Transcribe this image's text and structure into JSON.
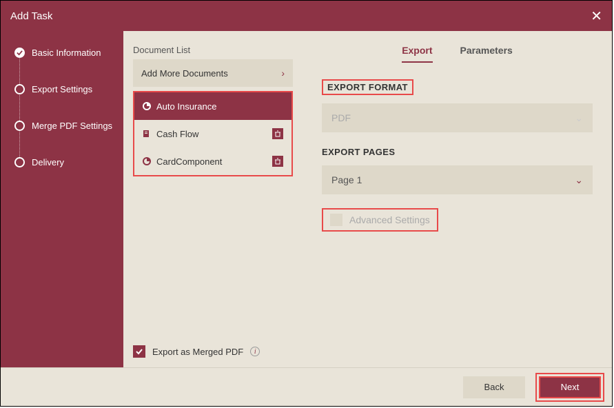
{
  "title": "Add Task",
  "steps": [
    {
      "label": "Basic Information",
      "done": true
    },
    {
      "label": "Export Settings",
      "done": false
    },
    {
      "label": "Merge PDF Settings",
      "done": false
    },
    {
      "label": "Delivery",
      "done": false
    }
  ],
  "documentList": {
    "label": "Document List",
    "addMore": "Add More Documents",
    "items": [
      {
        "label": "Auto Insurance",
        "selected": true
      },
      {
        "label": "Cash Flow",
        "selected": false
      },
      {
        "label": "CardComponent",
        "selected": false
      }
    ],
    "mergeLabel": "Export as Merged PDF"
  },
  "tabs": {
    "export": "Export",
    "parameters": "Parameters"
  },
  "labels": {
    "exportFormat": "EXPORT FORMAT",
    "exportPages": "EXPORT PAGES",
    "advanced": "Advanced Settings"
  },
  "values": {
    "format": "PDF",
    "page": "Page 1"
  },
  "buttons": {
    "back": "Back",
    "next": "Next"
  }
}
